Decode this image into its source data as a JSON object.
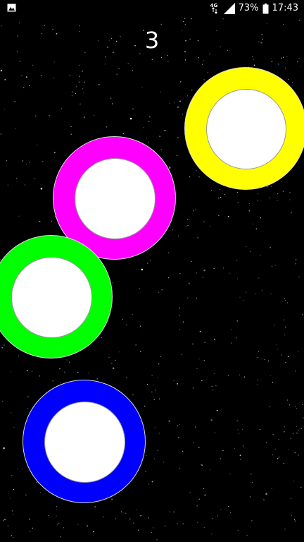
{
  "status_bar": {
    "network_label": "4G",
    "battery_percent": "73%",
    "time": "17:43",
    "icons": [
      "image-notification-icon",
      "network-4g-icon",
      "signal-icon",
      "battery-icon"
    ]
  },
  "game": {
    "score": "3",
    "background": "starfield",
    "rings": [
      {
        "name": "yellow-ring",
        "color": "#ffff00"
      },
      {
        "name": "magenta-ring",
        "color": "#ff00ff"
      },
      {
        "name": "green-ring",
        "color": "#00ff00"
      },
      {
        "name": "blue-ring",
        "color": "#0000ff"
      }
    ]
  }
}
